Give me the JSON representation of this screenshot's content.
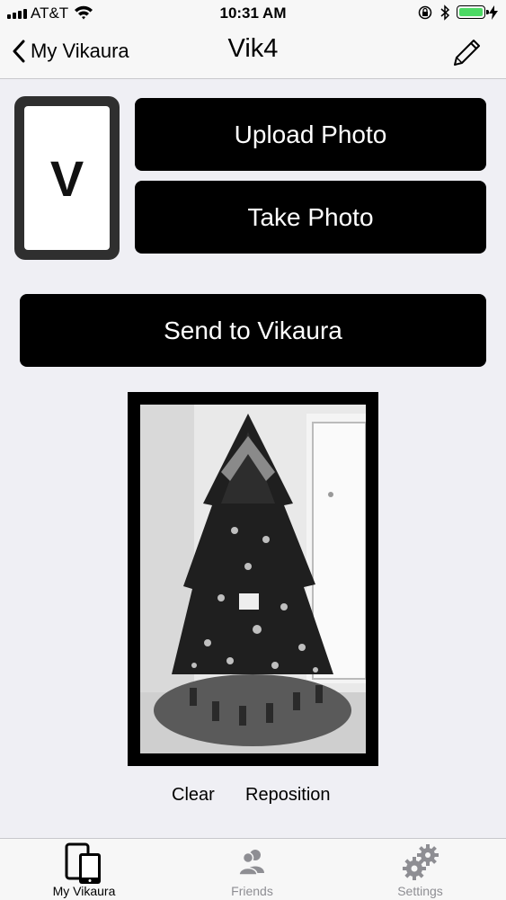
{
  "status_bar": {
    "carrier": "AT&T",
    "time": "10:31 AM",
    "battery_level": 1.0,
    "battery_color": "#4cd964"
  },
  "nav": {
    "back_label": "My Vikaura",
    "title": "Vik4",
    "edit_icon": "pencil-icon"
  },
  "device_thumbnail": {
    "letter": "V"
  },
  "buttons": {
    "upload": "Upload Photo",
    "take": "Take Photo",
    "send": "Send to Vikaura"
  },
  "photo_actions": {
    "clear": "Clear",
    "reposition": "Reposition"
  },
  "tabs": [
    {
      "label": "My Vikaura",
      "icon": "devices-icon",
      "active": true
    },
    {
      "label": "Friends",
      "icon": "friends-icon",
      "active": false
    },
    {
      "label": "Settings",
      "icon": "settings-gears-icon",
      "active": false
    }
  ],
  "colors": {
    "accent": "#000000",
    "inactive": "#8e8e93",
    "background": "#efeff4"
  }
}
